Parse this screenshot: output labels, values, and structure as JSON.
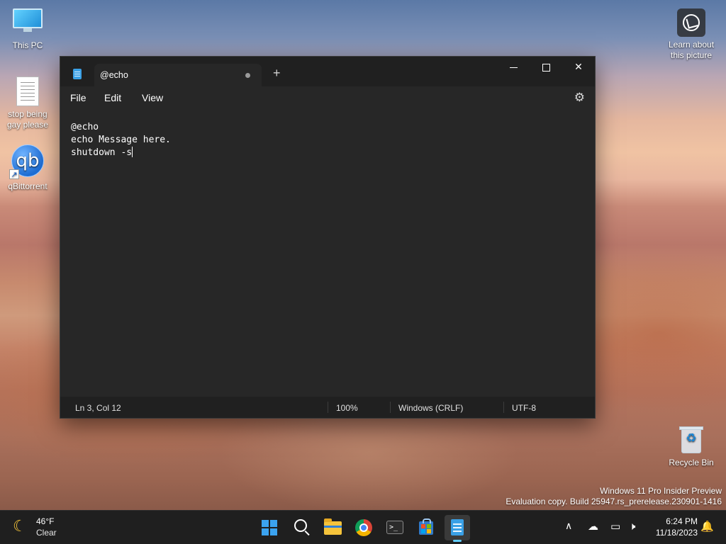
{
  "desktop": {
    "icons": [
      {
        "label": "This PC"
      },
      {
        "label": "stop being gay please"
      },
      {
        "label": "qBittorrent",
        "glyph": "qb"
      },
      {
        "label": "Recycle Bin"
      }
    ],
    "learn_label": "Learn about this picture",
    "watermark_line1": "Windows 11 Pro Insider Preview",
    "watermark_line2": "Evaluation copy. Build 25947.rs_prerelease.230901-1416"
  },
  "window": {
    "tab_title": "@echo",
    "new_tab_symbol": "+",
    "menu": {
      "file": "File",
      "edit": "Edit",
      "view": "View"
    },
    "content_lines": [
      "@echo",
      "echo Message here.",
      "shutdown -s"
    ],
    "status": {
      "position": "Ln 3, Col 12",
      "zoom": "100%",
      "line_ending": "Windows (CRLF)",
      "encoding": "UTF-8"
    }
  },
  "taskbar": {
    "weather_temp": "46°F",
    "weather_condition": "Clear",
    "time": "6:24 PM",
    "date": "11/18/2023",
    "apps": [
      "start-icon",
      "search-icon",
      "file-explorer-icon",
      "chrome-icon",
      "terminal-icon",
      "store-icon",
      "notepad-icon"
    ],
    "accent": "#60cdff"
  }
}
